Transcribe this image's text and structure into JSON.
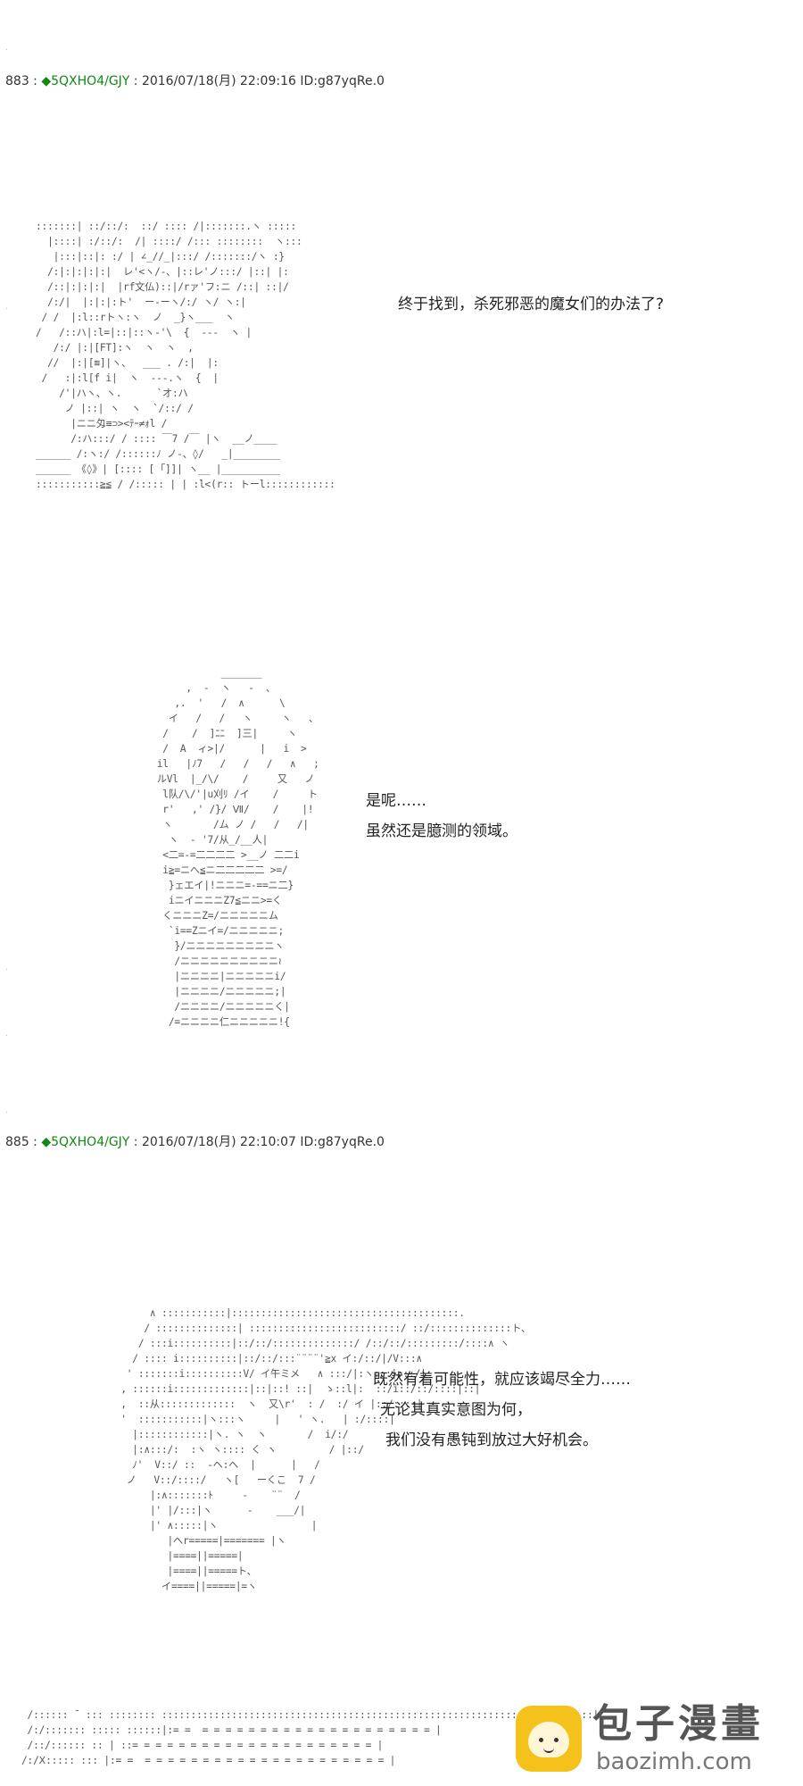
{
  "page": {
    "background": "#ffffff",
    "text_color": "#333333",
    "trip_color": "#118811"
  },
  "decor": {
    "dot": "."
  },
  "posts": [
    {
      "number": "883",
      "sep": " : ",
      "trip": "◆5QXHO4/GJY",
      "meta": " : 2016/07/18(月) 22:09:16 ID:g87yqRe.0"
    },
    {
      "number": "885",
      "sep": " : ",
      "trip": "◆5QXHO4/GJY",
      "meta": " : 2016/07/18(月) 22:10:07 ID:g87yqRe.0"
    }
  ],
  "art": {
    "a1": ":::::::| ::/::/:  ::/ :::: /|:::::::.ヽ :::::\n  |::::| :/::/:  /| ::::/ /::: ::::::::  ヽ:::\n   |:::|::|: :/ | ∠_//_|:::/ /:::::::/ヽ :}\n  /:|:|:|:|:|  レ'<ヽ/-、|::レ'ノ:::/ |::| |:\n  /::|:|:|:|  |rf文仏)::|/rァ'フ:ニ /::| ::|/\n  /:/|  |:|:|:ト'  ー-ーヽ/:/ ヽ/ ヽ:|\n / /  |:l::rトヽ:ヽ  ノ  _}ヽ___  ヽ\n/   /::ハ|:l=|::|::ヽ-'\\  {  ---  ヽ |\n   /:/ |:|[FT]:ヽ  ヽ  ヽ  ,\n  //  |:|[≡]|ヽ、  ___ . /:|  |:\n /   :|:l[f i|  ヽ  ---.ヽ  {  |\n    /'|ハヽ、ヽ.      `オ:ハ\n     ノ |::| ヽ  ヽ  `/::/ /\n      |ニニ匁≡⊃><ﾃｰ≠ｫl /\n      /:ハ:::/ / :::: ￣7 /￣ |ヽ  __ノ____\n______ /:ヽ:/ /::::::ﾉ ノ-、◊/   _|________\n______ 《◊》| [:::: [ ｢]]| ヽ__ |__________\n:::::::::::≧≦ / /::::: | | :l<(r:: トーl::::::::::::",
    "a2": "                  _______\n            ,  -  ヽ   -  、\n          ,.  '   /  ∧      \\\n         イ   /   /   ヽ     ヽ   、\n        /    /  ]ﾆﾆ  ]三|     ヽ\n        /  A  ィ>|/      |   i  >\n       il   |ﾉ7   /   /   /   ∧   ;\n       ルVl  |_/\\/    /     又   ノ\n        l队/\\/'|u刈ﾘ /イ    /     ト\n        r'   ,' /}/ Ⅶ/    /    |!\n        ヽ       /ム ノ /   /   /|\n         ヽ  ‐ '7/从_/__人|\n        <二=-=二二二二 >__ノ 二二i\n        i≧=ニへ≦ニ二二二二二 >=/\n         }ェエイ|!ニニニ=-==ニ二}\n         iニイニニニΖ7≦ニニ>=く\n        くニニニZ=/ニニニニニム\n         `i==Zニイ=/ニニニニニ;\n          }/ニニニニニニニニニヽ\n          /ニニニニニニニニニニ≀\n          |ニニニニ|ニニニニニi/\n          |ニニニニ/ニニニニニ;|\n          /ニニニニ/ニニニニニく|\n         /=ニニニニ仁ニニニニニ!{",
    "a3": "           ∧ :::::::::::|:::::::::::::::::::::::::::::::::::::::.\n          / ::::::::::::::| ::::::::::::::::::::::::::/ ::/::::::::::::::ト、\n         / :::i::::::::::|::/::/::::::::::::::/ /::/::/:::::::::/::::∧ ヽ\n        / :::: i::::::::::|::/::/:::¨¨¨¨'≧x イ:/::/|/V:::∧\n       ' :::::::i::::::::::V/ イ午ミメ   ∧ :::/|:ヽ:::|:::/|\n      , ::::::i:::::::::::::|::|::! ::|  ゝ::l|:  ::/i::/::/::::|::|\n      ,  ::从:::::::::::::  ヽ  又\\r'  : /  :/ イ |::/::::|\n      '  :::::::::::|ヽ:::ヽ     |   ' ヽ.   | :/::::|\n        |::::::::::::|ヽ. ヽ  ヽ       /  i/:/\n        |:∧:::/:  :ヽ ヽ:::: く ヽ         / |::/\n        ﾉ'  V::/ ::  -ヘ:ヘ  |      |   /\n       ノ   V::/::::/   ヽ[   ーくこ  7 /\n           |:∧:::::::ﾄ     -    ¨¨  /\n           |' |/:::|ヽ      -    ___/|\n           |' ∧:::::|ヽ                |\n              |ヘr=====|======= |ヽ\n              |====||=====|\n              |====||=====ト、\n             イ====||=====|=ヽ",
    "a4": " /:::::: ̄  ::: :::::::: ::::::::::::::::::::::::::::::::::::::::::::::::::::::::::::::::::::::::::|\n /:/::::::: ::::: ::::::|:= =  = = = = = = = = = = = = = = = = = = = = |\n /::/:::::: :: | ::= = = = = = = = = = = = = = = = = = = = = |\n/:/Ⅹ::::: ::: |:= =  = = = = = = = = = = = = = = = = = = = = = |"
  },
  "dialog": {
    "d1": [
      "终于找到，杀死邪恶的魔女们的办法了?"
    ],
    "d2": [
      "是呢……",
      "虽然还是臆测的领域。"
    ],
    "d3": [
      "既然有着可能性，就应该竭尽全力……",
      "无论其真实意图为何，",
      "我们没有愚钝到放过大好机会。"
    ]
  },
  "watermark": {
    "title": "包子漫畫",
    "url": "baozimh.com",
    "badge_color": "#f4c21a"
  }
}
